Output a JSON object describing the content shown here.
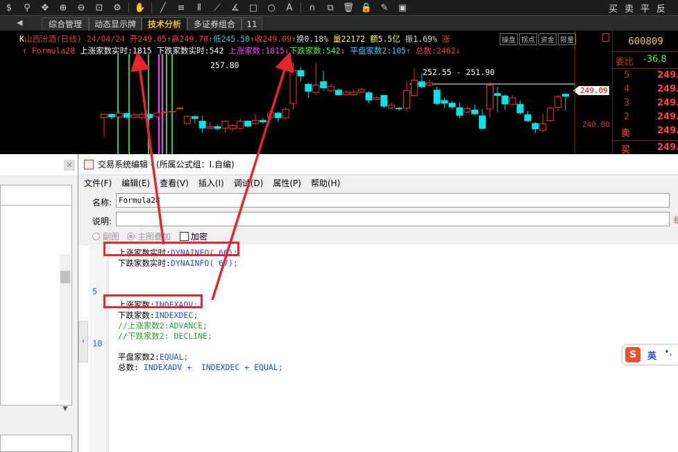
{
  "toolbar": {
    "icons": [
      "dollar-icon",
      "filter-icon",
      "crosshair-icon",
      "zoom-in-icon",
      "zoom-out-icon",
      "fit-icon",
      "gear-icon",
      "hand-icon",
      "line-tool-icon",
      "hline-icon",
      "vlines-icon",
      "fan-icon",
      "angle-icon",
      "rect-icon",
      "circle-icon",
      "text-icon",
      "magnet-icon",
      "copy-icon",
      "delete-icon",
      "lock-icon",
      "pen-icon",
      "save-icon"
    ],
    "trade_buttons": [
      "买",
      "卖",
      "平",
      "反"
    ]
  },
  "tabs": [
    {
      "label": "综合管理"
    },
    {
      "label": "动态显示牌"
    },
    {
      "label": "技术分析"
    },
    {
      "label": "多证券组合"
    },
    {
      "label": "11"
    }
  ],
  "chart": {
    "info_line1": [
      {
        "text": "K",
        "color": "#ffffff"
      },
      {
        "text": "山西汾酒(日线) 24/04/24 ",
        "color": "#d04040"
      },
      {
        "text": "开249.65",
        "color": "#ff4040"
      },
      {
        "text": "↑",
        "color": "#ff4040"
      },
      {
        "text": "高249.70",
        "color": "#ff4040"
      },
      {
        "text": "↑",
        "color": "#ff4040"
      },
      {
        "text": "低245.50",
        "color": "#33cccc"
      },
      {
        "text": "↑",
        "color": "#ff4040"
      },
      {
        "text": "收249.09",
        "color": "#ff4040"
      },
      {
        "text": "↑",
        "color": "#ff4040"
      },
      {
        "text": "换0.18%",
        "color": "#dddddd"
      },
      {
        "text": " 量22172",
        "color": "#ffff40"
      },
      {
        "text": " 额5.5亿",
        "color": "#ffff40"
      },
      {
        "text": " 振1.69%",
        "color": "#dddddd"
      },
      {
        "text": " 涨",
        "color": "#ff4040"
      }
    ],
    "info_badges": [
      "操盘",
      "拐点",
      "资金",
      "限量"
    ],
    "info_line2": [
      {
        "text": "↑ Formula28 ",
        "color": "#ff4040"
      },
      {
        "text": "上涨家数实时:",
        "color": "#ffffff"
      },
      {
        "text": "1815",
        "color": "#ffffff"
      },
      {
        "text": " 下跌家数实时:",
        "color": "#ffffff"
      },
      {
        "text": "542",
        "color": "#ffffff"
      },
      {
        "text": " 上涨家数:",
        "color": "#ff40ff"
      },
      {
        "text": "1815",
        "color": "#ff40ff"
      },
      {
        "text": "↓",
        "color": "#ff4040"
      },
      {
        "text": "下跌家数:",
        "color": "#40ff40"
      },
      {
        "text": "542",
        "color": "#40ff40"
      },
      {
        "text": "↓",
        "color": "#ff4040"
      },
      {
        "text": " 平盘家数2:",
        "color": "#40ccff"
      },
      {
        "text": "105",
        "color": "#40ccff"
      },
      {
        "text": "↑",
        "color": "#ff4040"
      },
      {
        "text": " 总数:",
        "color": "#ff4040"
      },
      {
        "text": "2462",
        "color": "#ff4040"
      },
      {
        "text": "↓",
        "color": "#ff4040"
      }
    ],
    "high_label": "257.80",
    "range_label": "252.55 - 251.90",
    "price_tag": "249.09",
    "axis_label": "240.00",
    "candles": [
      {
        "o": 243.5,
        "c": 244.4,
        "h": 244.6,
        "l": 238.5
      },
      {
        "o": 244.4,
        "c": 243.7,
        "h": 244.6,
        "l": 243.2
      },
      {
        "o": 243.7,
        "c": 244.7,
        "h": 245.2,
        "l": 243.2
      },
      {
        "o": 244.6,
        "c": 243.6,
        "h": 244.9,
        "l": 243.2
      },
      {
        "o": 243.6,
        "c": 244.2,
        "h": 244.8,
        "l": 243.3
      },
      {
        "o": 243.5,
        "c": 244.4,
        "h": 244.9,
        "l": 243.0
      },
      {
        "o": 244.4,
        "c": 243.5,
        "h": 244.6,
        "l": 243.0
      },
      {
        "o": 243.8,
        "c": 244.7,
        "h": 244.9,
        "l": 243.4
      },
      {
        "o": 245.0,
        "c": 245.0,
        "h": 245.2,
        "l": 244.8
      },
      {
        "o": 245.2,
        "c": 245.2,
        "h": 245.6,
        "l": 244.8
      },
      {
        "o": 246.0,
        "c": 246.0,
        "h": 246.4,
        "l": 245.6
      },
      {
        "o": 242.0,
        "c": 243.8,
        "h": 244.2,
        "l": 241.7
      },
      {
        "o": 243.8,
        "c": 243.3,
        "h": 244.1,
        "l": 242.0
      },
      {
        "o": 242.6,
        "c": 240.8,
        "h": 244.0,
        "l": 239.5
      },
      {
        "o": 240.8,
        "c": 241.2,
        "h": 242.3,
        "l": 240.5
      },
      {
        "o": 241.2,
        "c": 240.7,
        "h": 241.6,
        "l": 240.3
      },
      {
        "o": 240.8,
        "c": 242.6,
        "h": 242.8,
        "l": 239.6
      },
      {
        "o": 240.6,
        "c": 241.5,
        "h": 241.8,
        "l": 240.0
      },
      {
        "o": 240.7,
        "c": 242.6,
        "h": 243.2,
        "l": 240.3
      },
      {
        "o": 242.6,
        "c": 241.3,
        "h": 242.9,
        "l": 241.0
      },
      {
        "o": 242.0,
        "c": 242.8,
        "h": 244.5,
        "l": 241.7
      },
      {
        "o": 242.8,
        "c": 242.4,
        "h": 243.5,
        "l": 242.0
      },
      {
        "o": 243.7,
        "c": 244.7,
        "h": 245.5,
        "l": 242.8
      },
      {
        "o": 244.7,
        "c": 243.5,
        "h": 245.0,
        "l": 242.3
      },
      {
        "o": 243.4,
        "c": 245.7,
        "h": 246.2,
        "l": 243.0
      },
      {
        "o": 247.2,
        "c": 255.8,
        "h": 257.8,
        "l": 245.6
      },
      {
        "o": 255.8,
        "c": 254.4,
        "h": 256.7,
        "l": 253.0
      },
      {
        "o": 252.2,
        "c": 250.4,
        "h": 252.6,
        "l": 248.7
      },
      {
        "o": 250.1,
        "c": 252.0,
        "h": 257.8,
        "l": 249.6
      },
      {
        "o": 252.9,
        "c": 251.3,
        "h": 255.8,
        "l": 250.5
      },
      {
        "o": 250.5,
        "c": 251.7,
        "h": 252.3,
        "l": 250.2
      },
      {
        "o": 250.7,
        "c": 249.5,
        "h": 251.2,
        "l": 249.2
      },
      {
        "o": 249.5,
        "c": 250.2,
        "h": 250.6,
        "l": 249.3
      },
      {
        "o": 249.5,
        "c": 250.2,
        "h": 250.8,
        "l": 249.2
      },
      {
        "o": 250.2,
        "c": 250.9,
        "h": 251.3,
        "l": 250.0
      },
      {
        "o": 250.0,
        "c": 248.1,
        "h": 250.4,
        "l": 247.3
      },
      {
        "o": 248.3,
        "c": 248.7,
        "h": 249.1,
        "l": 248.0
      },
      {
        "o": 249.3,
        "c": 246.5,
        "h": 249.6,
        "l": 246.1
      },
      {
        "o": 246.0,
        "c": 246.8,
        "h": 247.5,
        "l": 245.6
      },
      {
        "o": 246.0,
        "c": 245.8,
        "h": 246.3,
        "l": 245.4
      },
      {
        "o": 246.0,
        "c": 250.6,
        "h": 252.9,
        "l": 245.1
      },
      {
        "o": 249.3,
        "c": 253.3,
        "h": 256.4,
        "l": 249.0
      },
      {
        "o": 252.9,
        "c": 251.6,
        "h": 255.1,
        "l": 251.2
      },
      {
        "o": 252.0,
        "c": 252.6,
        "h": 253.4,
        "l": 251.6
      },
      {
        "o": 250.7,
        "c": 247.2,
        "h": 251.6,
        "l": 246.8
      },
      {
        "o": 248.0,
        "c": 247.3,
        "h": 248.8,
        "l": 246.0
      },
      {
        "o": 247.3,
        "c": 246.3,
        "h": 247.8,
        "l": 245.9
      },
      {
        "o": 246.1,
        "c": 244.1,
        "h": 247.5,
        "l": 243.3
      },
      {
        "o": 245.0,
        "c": 245.9,
        "h": 246.4,
        "l": 244.6
      },
      {
        "o": 245.5,
        "c": 244.5,
        "h": 247.0,
        "l": 244.2
      },
      {
        "o": 244.0,
        "c": 240.7,
        "h": 245.8,
        "l": 240.3
      },
      {
        "o": 245.8,
        "c": 252.0,
        "h": 252.9,
        "l": 243.5
      },
      {
        "o": 249.8,
        "c": 249.3,
        "h": 251.6,
        "l": 245.0
      },
      {
        "o": 249.2,
        "c": 247.1,
        "h": 249.6,
        "l": 245.6
      },
      {
        "o": 247.0,
        "c": 248.7,
        "h": 249.4,
        "l": 246.6
      },
      {
        "o": 247.0,
        "c": 244.8,
        "h": 248.0,
        "l": 244.3
      },
      {
        "o": 244.3,
        "c": 242.7,
        "h": 245.2,
        "l": 242.4
      },
      {
        "o": 242.0,
        "c": 240.6,
        "h": 242.3,
        "l": 239.4
      },
      {
        "o": 240.2,
        "c": 241.9,
        "h": 244.5,
        "l": 239.8
      },
      {
        "o": 242.8,
        "c": 246.0,
        "h": 246.4,
        "l": 242.3
      },
      {
        "o": 246.2,
        "c": 249.0,
        "h": 249.4,
        "l": 245.2
      },
      {
        "o": 249.65,
        "c": 249.09,
        "h": 249.7,
        "l": 245.5
      }
    ]
  },
  "quote_panel": {
    "code": "600809",
    "ratio_label": "委比",
    "ratio_value": "-36.8",
    "rows": [
      {
        "label": "5",
        "price": "249."
      },
      {
        "label": "4",
        "price": "249."
      },
      {
        "label": "3",
        "price": "249."
      },
      {
        "label": "2",
        "price": "249."
      },
      {
        "label": "卖",
        "price": "249."
      },
      {
        "label": "买",
        "price": "249."
      }
    ]
  },
  "editor": {
    "title": "交易系统编辑 - (所属公式组：I.自编)",
    "menu": [
      "文件(F)",
      "编辑(E)",
      "查看(V)",
      "插入(I)",
      "调试(D)",
      "属性(P)",
      "帮助(H)"
    ],
    "name_label": "名称:",
    "name_value": "Formula28",
    "desc_label": "说明:",
    "desc_value": "",
    "radio_sub": "副图",
    "radio_main": "主图叠加",
    "check_encrypt": "加密",
    "line_numbers": [
      {
        "n": "5"
      },
      {
        "n": "10"
      }
    ],
    "code_lines": [
      {
        "label": "上涨家数实时:",
        "fn": "DYNAINFO( 66);"
      },
      {
        "label": "下跌家数实时:",
        "fn": "DYNAINFO( 67);"
      },
      {
        "label": "",
        "fn": ""
      },
      {
        "label": "",
        "fn": ""
      },
      {
        "label": "",
        "fn": ""
      },
      {
        "label": "上涨家数:",
        "fn": "INDEXADV;"
      },
      {
        "label": "下跌家数:",
        "fn": "INDEXDEC;"
      },
      {
        "label": "//上涨家数2:ADVANCE;",
        "fn": ""
      },
      {
        "label": "//下跌家数2: DECLINE;",
        "fn": ""
      },
      {
        "label": "",
        "fn": ""
      },
      {
        "label": "平盘家数2:",
        "fn": "EQUAL;"
      },
      {
        "label": "总数: ",
        "fn": "INDEXADV +  INDEXDEC + EQUAL;"
      }
    ]
  },
  "ime": {
    "label": "英"
  }
}
